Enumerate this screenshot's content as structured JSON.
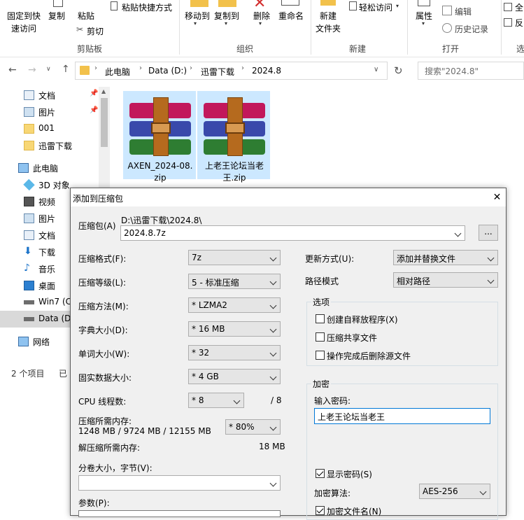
{
  "ribbon": {
    "pin_label_1": "固定到快",
    "pin_label_2": "速访问",
    "copy": "复制",
    "paste": "粘贴",
    "paste_shortcut": "粘贴快捷方式",
    "cut": "剪切",
    "move_to": "移动到",
    "copy_to": "复制到",
    "delete": "删除",
    "rename": "重命名",
    "new_folder_1": "新建",
    "new_folder_2": "文件夹",
    "easy_access": "轻松访问",
    "properties": "属性",
    "edit": "编辑",
    "history": "历史记录",
    "select_all": "全",
    "invert": "反",
    "group_clipboard": "剪贴板",
    "group_organize": "组织",
    "group_new": "新建",
    "group_open": "打开",
    "group_select": "选"
  },
  "address": {
    "crumbs": [
      "此电脑",
      "Data (D:)",
      "迅雷下载",
      "2024.8"
    ],
    "search_placeholder": "搜索\"2024.8\""
  },
  "nav": {
    "items": [
      "文档",
      "图片",
      "001",
      "迅雷下载",
      "此电脑",
      "3D 对象",
      "视频",
      "图片",
      "文档",
      "下载",
      "音乐",
      "桌面",
      "Win7 (C",
      "Data (D",
      "网络"
    ]
  },
  "status": {
    "count": "2 个项目",
    "selected": "已"
  },
  "files": [
    {
      "name_1": "AXEN_2024-08.",
      "name_2": "zip"
    },
    {
      "name_1": "上老王论坛当老",
      "name_2": "王.zip"
    }
  ],
  "dialog": {
    "title": "添加到压缩包",
    "archive_label": "压缩包(A)",
    "archive_path": "D:\\迅雷下载\\2024.8\\",
    "archive_name": "2024.8.7z",
    "browse": "...",
    "format_label": "压缩格式(F):",
    "format_value": "7z",
    "level_label": "压缩等级(L):",
    "level_value": "5 - 标准压缩",
    "method_label": "压缩方法(M):",
    "method_value": "* LZMA2",
    "dict_label": "字典大小(D):",
    "dict_value": "* 16 MB",
    "word_label": "单词大小(W):",
    "word_value": "* 32",
    "solid_label": "固实数据大小:",
    "solid_value": "* 4 GB",
    "threads_label": "CPU 线程数:",
    "threads_value": "* 8",
    "threads_max": "/ 8",
    "mem_label": "压缩所需内存:",
    "mem_value": "1248 MB / 9724 MB / 12155 MB",
    "mem_pct": "* 80%",
    "decomp_label": "解压缩所需内存:",
    "decomp_value": "18 MB",
    "split_label": "分卷大小，字节(V):",
    "split_value": "",
    "params_label": "参数(P):",
    "update_label": "更新方式(U):",
    "update_value": "添加并替换文件",
    "path_label": "路径模式",
    "path_value": "相对路径",
    "options_title": "选项",
    "opt_sfx": "创建自释放程序(X)",
    "opt_shared": "压缩共享文件",
    "opt_delete": "操作完成后删除源文件",
    "encrypt_title": "加密",
    "pw_label": "输入密码:",
    "pw_value": "上老王论坛当老王",
    "show_pw": "显示密码(S)",
    "algo_label": "加密算法:",
    "algo_value": "AES-256",
    "enc_names": "加密文件名(N)"
  }
}
